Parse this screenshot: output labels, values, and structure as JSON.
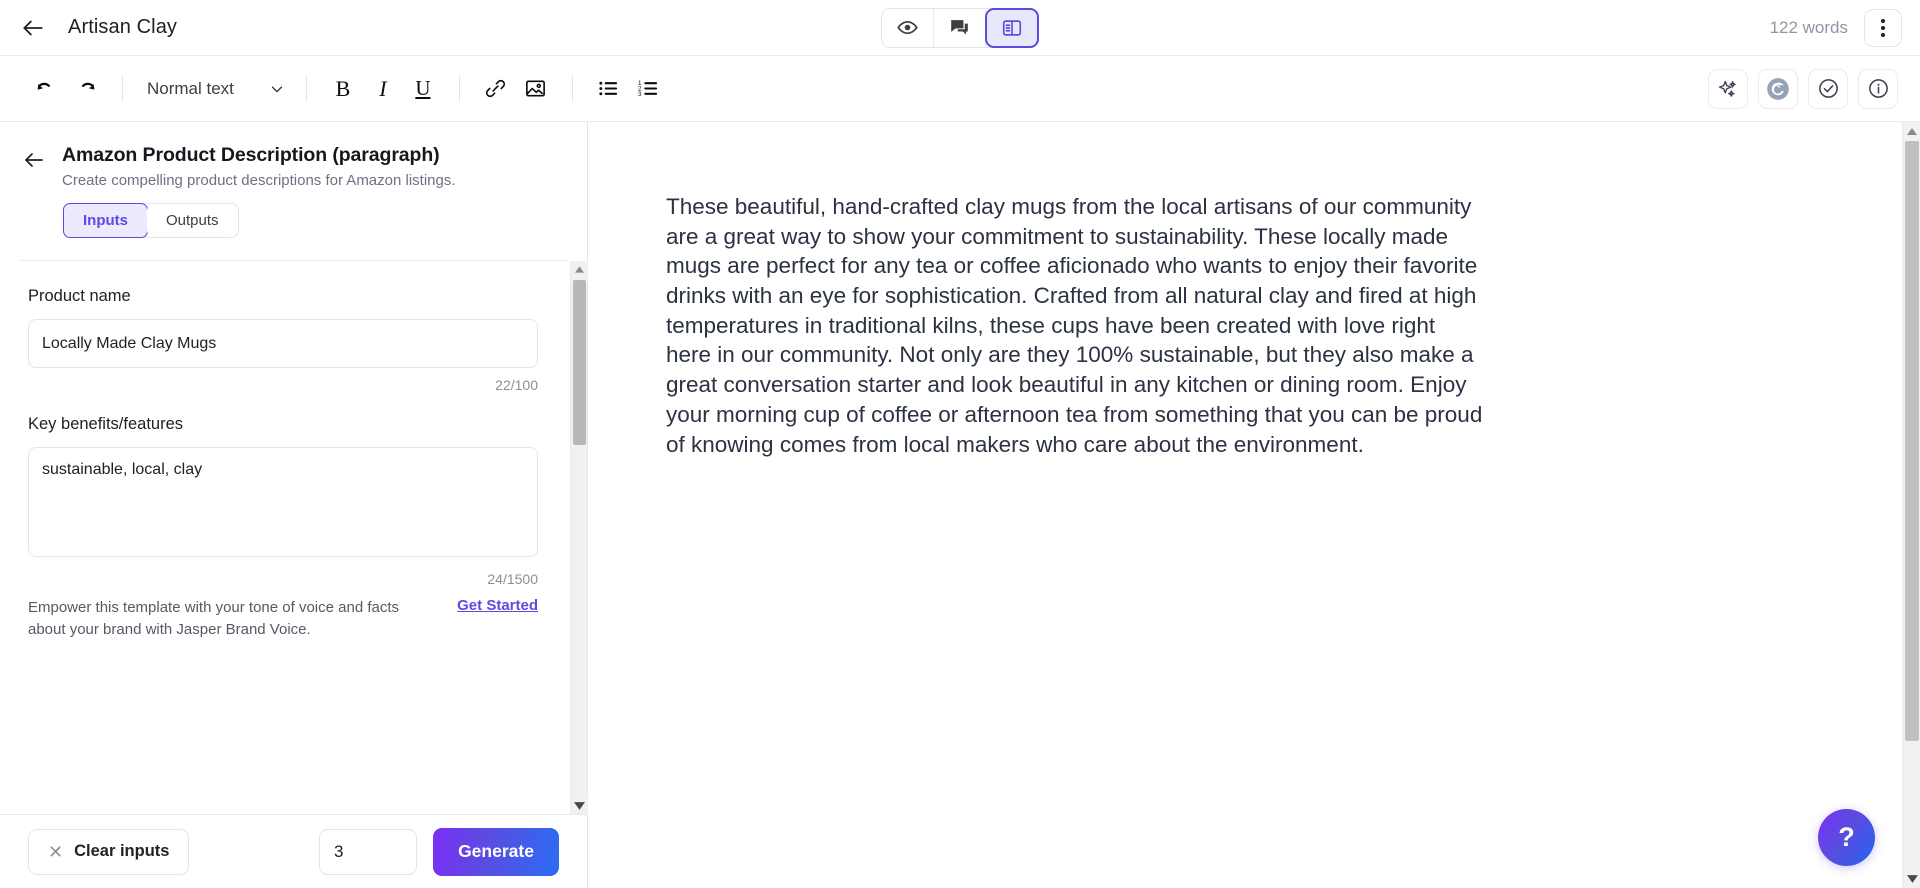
{
  "header": {
    "back_icon": "arrow-left-icon",
    "doc_title": "Artisan Clay",
    "view_toggles": [
      {
        "name": "preview-eye",
        "icon": "eye-icon",
        "active": false
      },
      {
        "name": "comments",
        "icon": "comments-icon",
        "active": false
      },
      {
        "name": "side-panel",
        "icon": "layout-panel-icon",
        "active": true
      }
    ],
    "word_count": "122 words",
    "menu_icon": "kebab-menu-icon"
  },
  "toolbar": {
    "undo_icon": "undo-icon",
    "redo_icon": "redo-icon",
    "style_label": "Normal text",
    "style_caret_icon": "chevron-down-icon",
    "bold_label": "B",
    "italic_label": "I",
    "underline_label": "U",
    "link_icon": "link-icon",
    "image_icon": "image-icon",
    "bullet_list_icon": "bullet-list-icon",
    "numbered_list_icon": "numbered-list-icon",
    "right_tools": [
      {
        "name": "ai-sparkle",
        "icon": "sparkles-icon"
      },
      {
        "name": "grammarly",
        "icon": "grammarly-g-icon"
      },
      {
        "name": "check",
        "icon": "check-circle-icon"
      },
      {
        "name": "info",
        "icon": "info-circle-icon"
      }
    ]
  },
  "panel": {
    "back_icon": "arrow-left-icon",
    "template_title": "Amazon Product Description (paragraph)",
    "template_subtitle": "Create compelling product descriptions for Amazon listings.",
    "tabs": [
      {
        "label": "Inputs",
        "active": true
      },
      {
        "label": "Outputs",
        "active": false
      }
    ],
    "fields": [
      {
        "label": "Product name",
        "value": "Locally Made Clay Mugs",
        "placeholder": "",
        "counter": "22/100"
      },
      {
        "label": "Key benefits/features",
        "value": "sustainable, local, clay",
        "placeholder": "",
        "counter": "24/1500"
      }
    ],
    "brand_note": "Empower this template with your tone of voice and facts about your brand with Jasper Brand Voice.",
    "brand_note_link": "Get Started",
    "footer": {
      "clear_label": "Clear inputs",
      "clear_icon": "close-x-icon",
      "output_count": "3",
      "generate_label": "Generate"
    }
  },
  "document": {
    "content": "These beautiful, hand-crafted clay mugs from the local artisans of our community are a great way to show your commitment to sustainability. These locally made mugs are perfect for any tea or coffee aficionado who wants to enjoy their favorite drinks with an eye for sophistication. Crafted from all natural clay and fired at high temperatures in traditional kilns, these cups have been created with love right here in our community. Not only are they 100% sustainable, but they also make a great conversation starter and look beautiful in any kitchen or dining room. Enjoy your morning cup of coffee or afternoon tea from something that you can be proud of knowing comes from local makers who care about the environment."
  },
  "help": {
    "label": "?"
  },
  "colors": {
    "accent_purple": "#5b4ce0",
    "accent_bg": "#eceafc",
    "text_primary": "#202124",
    "text_muted": "#6b7280",
    "border": "#e3e5e9"
  }
}
